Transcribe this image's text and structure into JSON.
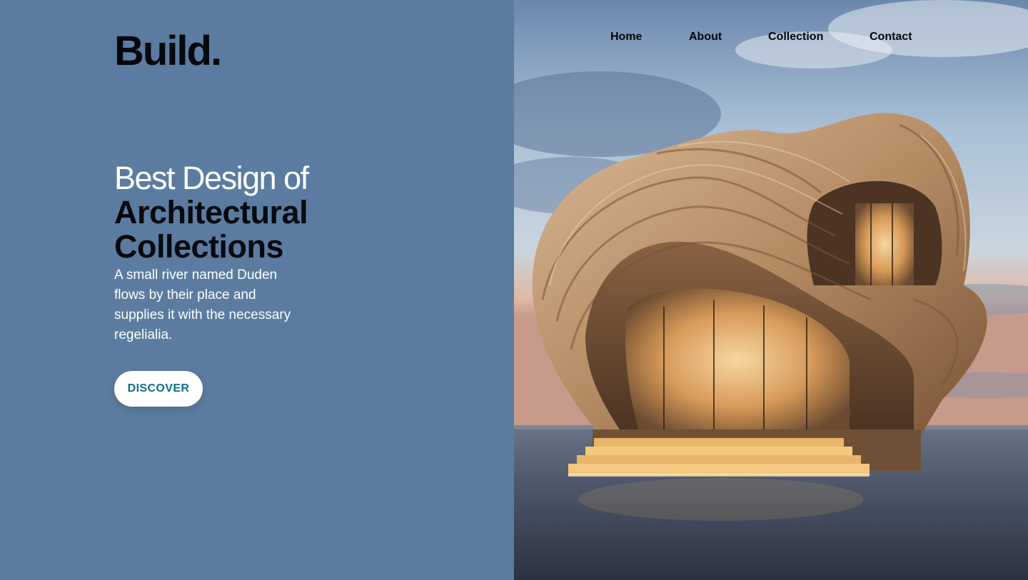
{
  "brand": {
    "logo": "Build."
  },
  "nav": {
    "items": [
      "Home",
      "About",
      "Collection",
      "Contact"
    ]
  },
  "hero": {
    "title_light": "Best Design of",
    "title_bold_1": "Architectural",
    "title_bold_2": "Collections",
    "description": "A small river named Duden flows by their place and supplies it with the necessary regelialia.",
    "cta_label": "DISCOVER"
  },
  "colors": {
    "left_panel_bg": "#5b7ca0",
    "cta_text": "#0b6f8a",
    "text_dark": "#05080d",
    "text_light": "#ffffff"
  },
  "image": {
    "subject": "organic-wooden-architecture-on-water-photo"
  }
}
